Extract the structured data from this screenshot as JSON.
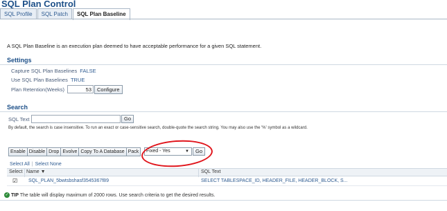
{
  "page": {
    "title": "SQL Plan Control"
  },
  "tabs": [
    {
      "label": "SQL Profile"
    },
    {
      "label": "SQL Patch"
    },
    {
      "label": "SQL Plan Baseline"
    }
  ],
  "intro": "A SQL Plan Baseline is an execution plan deemed to have acceptable performance for a given SQL statement.",
  "settings": {
    "header": "Settings",
    "capture_label": "Capture SQL Plan Baselines",
    "capture_value": "FALSE",
    "use_label": "Use SQL Plan Baselines",
    "use_value": "TRUE",
    "retention_label": "Plan Retention(Weeks)",
    "retention_value": "53",
    "configure_button": "Configure"
  },
  "search": {
    "header": "Search",
    "sql_text_label": "SQL Text",
    "sql_text_value": "",
    "go_button": "Go",
    "hint": "By default, the search is case insensitive. To run an exact or case-sensitive search, double-quote the search string. You may also use the '%' symbol as a wildcard."
  },
  "toolbar": {
    "buttons": [
      "Enable",
      "Disable",
      "Drop",
      "Evolve",
      "Copy To A Database",
      "Pack"
    ],
    "select_value": "Fixed - Yes",
    "go_button": "Go"
  },
  "links": {
    "select_all": "Select All",
    "select_none": "Select None"
  },
  "table": {
    "headers": {
      "select": "Select",
      "name": "Name",
      "sql": "SQL Text"
    },
    "rows": [
      {
        "name": "SQL_PLAN_5bwtsbshasf3545367f89",
        "sql_text": "SELECT TABLESPACE_ID, HEADER_FILE, HEADER_BLOCK, S...",
        "checked": true
      }
    ]
  },
  "tip": {
    "label": "TIP",
    "text": "The table will display maximum of 2000 rows. Use search criteria to get the desired results."
  },
  "colors": {
    "annotation_circle": "#e0141b",
    "link": "#2e5b91",
    "header": "#1c4f88"
  }
}
